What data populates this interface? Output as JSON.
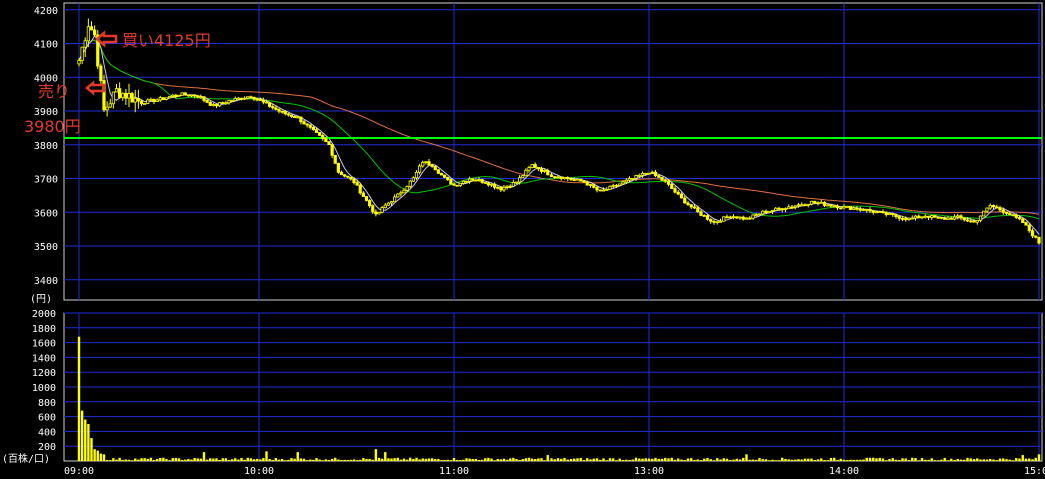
{
  "chart_data": [
    {
      "type": "candlestick",
      "panel": "price",
      "ylabel": "(円)",
      "ylim": [
        3340,
        4220
      ],
      "y_ticks": [
        3400,
        3500,
        3600,
        3700,
        3800,
        3900,
        4000,
        4100,
        4200
      ],
      "x_ticks": [
        "09:00",
        "10:00",
        "11:00",
        "13:00",
        "14:00",
        "15:00"
      ],
      "grid": true,
      "colors": {
        "background": "#000000",
        "grid": "#1f2bd6",
        "candle": "#ffff00",
        "ma_short": "#c8c8ff",
        "ma_mid": "#00c000",
        "ma_long": "#e07040",
        "level_line": "#00ff00",
        "annotation": "#e23a2a"
      },
      "horizontal_line": {
        "value": 3820
      },
      "close_series": [
        {
          "time": "09:00",
          "value": 4050
        },
        {
          "time": "09:03",
          "value": 4160
        },
        {
          "time": "09:05",
          "value": 4125
        },
        {
          "time": "09:08",
          "value": 3900
        },
        {
          "time": "09:12",
          "value": 3960
        },
        {
          "time": "09:16",
          "value": 3945
        },
        {
          "time": "09:20",
          "value": 3925
        },
        {
          "time": "09:26",
          "value": 3935
        },
        {
          "time": "09:32",
          "value": 3950
        },
        {
          "time": "09:38",
          "value": 3945
        },
        {
          "time": "09:43",
          "value": 3915
        },
        {
          "time": "09:48",
          "value": 3930
        },
        {
          "time": "09:55",
          "value": 3945
        },
        {
          "time": "10:00",
          "value": 3920
        },
        {
          "time": "10:05",
          "value": 3895
        },
        {
          "time": "10:10",
          "value": 3880
        },
        {
          "time": "10:15",
          "value": 3840
        },
        {
          "time": "10:20",
          "value": 3800
        },
        {
          "time": "10:23",
          "value": 3720
        },
        {
          "time": "10:28",
          "value": 3690
        },
        {
          "time": "10:33",
          "value": 3620
        },
        {
          "time": "10:35",
          "value": 3590
        },
        {
          "time": "10:38",
          "value": 3620
        },
        {
          "time": "10:42",
          "value": 3650
        },
        {
          "time": "10:47",
          "value": 3700
        },
        {
          "time": "10:50",
          "value": 3750
        },
        {
          "time": "10:53",
          "value": 3740
        },
        {
          "time": "10:57",
          "value": 3700
        },
        {
          "time": "11:00",
          "value": 3680
        },
        {
          "time": "11:05",
          "value": 3700
        },
        {
          "time": "11:10",
          "value": 3690
        },
        {
          "time": "11:15",
          "value": 3670
        },
        {
          "time": "11:20",
          "value": 3690
        },
        {
          "time": "11:25",
          "value": 3740
        },
        {
          "time": "11:30",
          "value": 3715
        },
        {
          "time": "12:30",
          "value": 3710
        },
        {
          "time": "12:35",
          "value": 3700
        },
        {
          "time": "12:40",
          "value": 3690
        },
        {
          "time": "12:45",
          "value": 3660
        },
        {
          "time": "12:50",
          "value": 3680
        },
        {
          "time": "12:55",
          "value": 3700
        },
        {
          "time": "13:00",
          "value": 3720
        },
        {
          "time": "13:05",
          "value": 3690
        },
        {
          "time": "13:10",
          "value": 3640
        },
        {
          "time": "13:15",
          "value": 3600
        },
        {
          "time": "13:20",
          "value": 3570
        },
        {
          "time": "13:25",
          "value": 3590
        },
        {
          "time": "13:30",
          "value": 3580
        },
        {
          "time": "13:35",
          "value": 3600
        },
        {
          "time": "13:40",
          "value": 3610
        },
        {
          "time": "13:45",
          "value": 3620
        },
        {
          "time": "13:50",
          "value": 3630
        },
        {
          "time": "14:00",
          "value": 3615
        },
        {
          "time": "14:05",
          "value": 3610
        },
        {
          "time": "14:10",
          "value": 3600
        },
        {
          "time": "14:15",
          "value": 3590
        },
        {
          "time": "14:20",
          "value": 3580
        },
        {
          "time": "14:25",
          "value": 3590
        },
        {
          "time": "14:30",
          "value": 3580
        },
        {
          "time": "14:35",
          "value": 3585
        },
        {
          "time": "14:40",
          "value": 3570
        },
        {
          "time": "14:45",
          "value": 3620
        },
        {
          "time": "14:50",
          "value": 3600
        },
        {
          "time": "14:55",
          "value": 3570
        },
        {
          "time": "15:00",
          "value": 3510
        }
      ],
      "annotations": {
        "buy": "買い4125円",
        "sell_label": "売り",
        "sell_price": "3980円"
      }
    },
    {
      "type": "bar",
      "panel": "volume",
      "ylabel": "(百株/口)",
      "ylim": [
        0,
        2000
      ],
      "y_ticks": [
        200,
        400,
        600,
        800,
        1000,
        1200,
        1400,
        1600,
        1800,
        2000
      ],
      "x_ticks": [
        "09:00",
        "10:00",
        "11:00",
        "13:00",
        "14:00",
        "15:00"
      ],
      "grid": true,
      "bars": [
        {
          "time": "09:00",
          "value": 1680
        },
        {
          "time": "09:01",
          "value": 680
        },
        {
          "time": "09:02",
          "value": 560
        },
        {
          "time": "09:03",
          "value": 500
        },
        {
          "time": "09:04",
          "value": 310
        },
        {
          "time": "09:05",
          "value": 160
        },
        {
          "time": "09:06",
          "value": 140
        },
        {
          "time": "09:07",
          "value": 100
        },
        {
          "time": "09:08",
          "value": 90
        },
        {
          "time": "09:40",
          "value": 120
        },
        {
          "time": "10:00",
          "value": 130
        },
        {
          "time": "10:10",
          "value": 120
        },
        {
          "time": "10:35",
          "value": 160
        },
        {
          "time": "10:38",
          "value": 120
        },
        {
          "time": "11:30",
          "value": 80
        },
        {
          "time": "12:05",
          "value": 90
        },
        {
          "time": "13:30",
          "value": 90
        },
        {
          "time": "14:55",
          "value": 80
        },
        {
          "time": "15:00",
          "value": 90
        }
      ]
    }
  ]
}
